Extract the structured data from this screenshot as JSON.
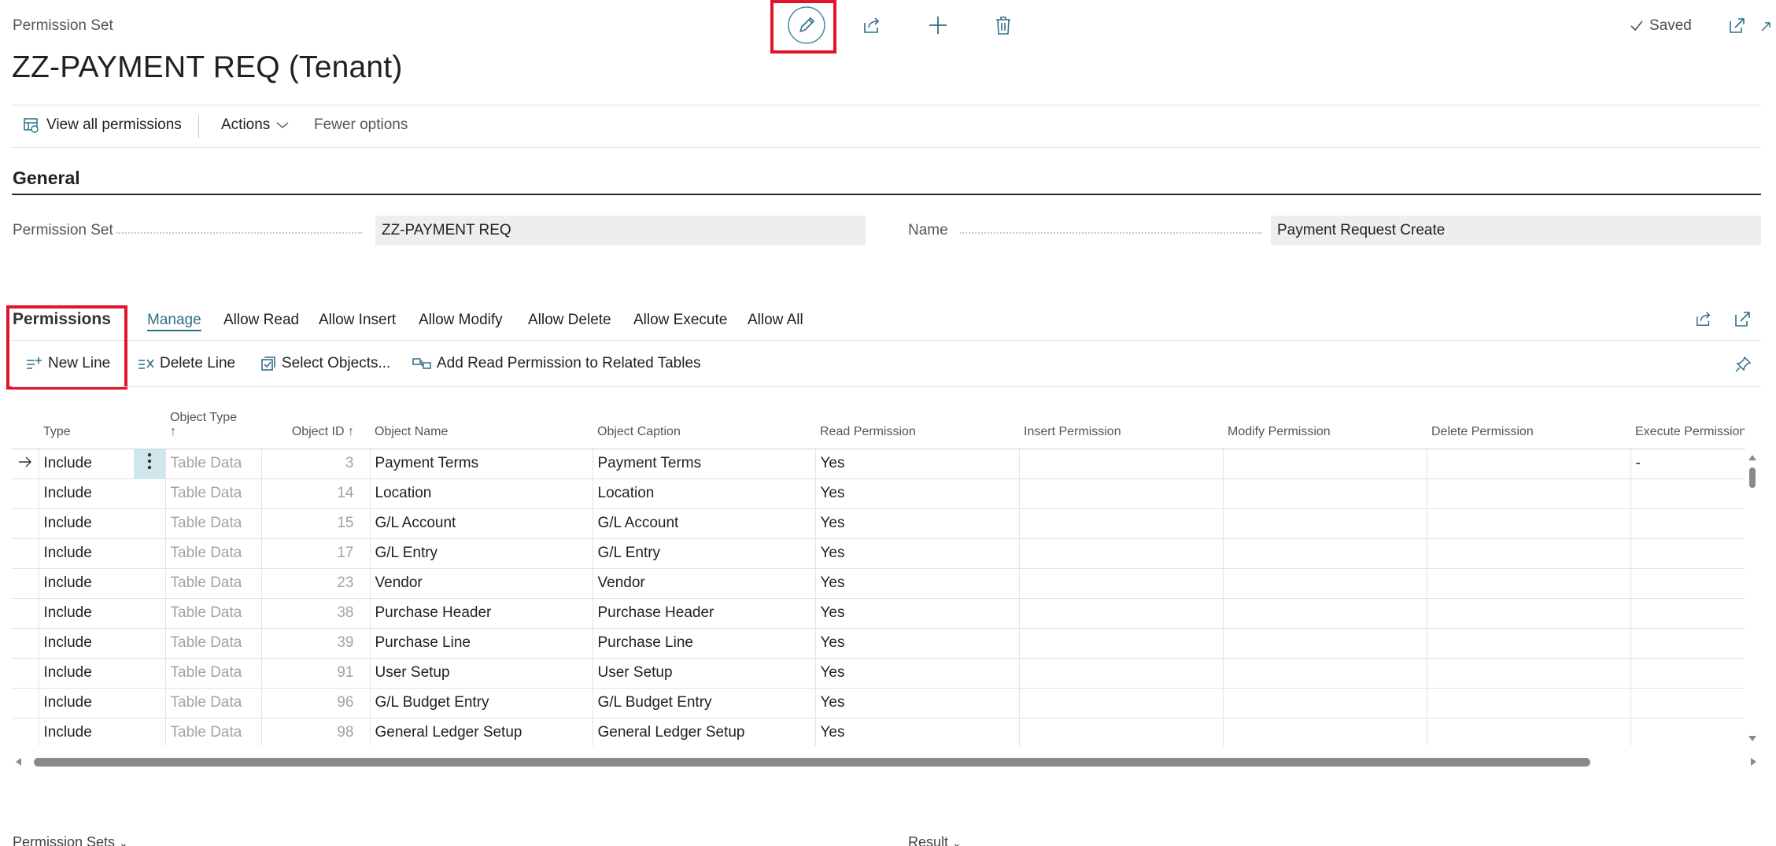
{
  "header": {
    "breadcrumb": "Permission Set",
    "title": "ZZ-PAYMENT REQ (Tenant)",
    "saved_label": "Saved"
  },
  "actions_bar": {
    "view_all": "View all permissions",
    "actions": "Actions",
    "fewer_options": "Fewer options"
  },
  "general": {
    "heading": "General",
    "permission_set_label": "Permission Set",
    "permission_set_value": "ZZ-PAYMENT REQ",
    "name_label": "Name",
    "name_value": "Payment Request Create"
  },
  "permissions": {
    "heading": "Permissions",
    "tabs": [
      "Manage",
      "Allow Read",
      "Allow Insert",
      "Allow Modify",
      "Allow Delete",
      "Allow Execute",
      "Allow All"
    ],
    "toolbar": {
      "new_line": "New Line",
      "delete_line": "Delete Line",
      "select_objects": "Select Objects...",
      "add_read": "Add Read Permission to Related Tables"
    },
    "columns": {
      "type": "Type",
      "object_type": "Object Type",
      "object_type_sort": "↑",
      "object_id": "Object ID",
      "object_id_sort": "↑",
      "object_name": "Object Name",
      "object_caption": "Object Caption",
      "read": "Read Permission",
      "insert": "Insert Permission",
      "modify": "Modify Permission",
      "delete": "Delete Permission",
      "execute": "Execute Permission"
    },
    "rows": [
      {
        "type": "Include",
        "object_type": "Table Data",
        "object_id": "3",
        "object_name": "Payment Terms",
        "object_caption": "Payment Terms",
        "read": "Yes",
        "insert": "",
        "modify": "",
        "delete": "",
        "execute": "-"
      },
      {
        "type": "Include",
        "object_type": "Table Data",
        "object_id": "14",
        "object_name": "Location",
        "object_caption": "Location",
        "read": "Yes",
        "insert": "",
        "modify": "",
        "delete": "",
        "execute": ""
      },
      {
        "type": "Include",
        "object_type": "Table Data",
        "object_id": "15",
        "object_name": "G/L Account",
        "object_caption": "G/L Account",
        "read": "Yes",
        "insert": "",
        "modify": "",
        "delete": "",
        "execute": ""
      },
      {
        "type": "Include",
        "object_type": "Table Data",
        "object_id": "17",
        "object_name": "G/L Entry",
        "object_caption": "G/L Entry",
        "read": "Yes",
        "insert": "",
        "modify": "",
        "delete": "",
        "execute": ""
      },
      {
        "type": "Include",
        "object_type": "Table Data",
        "object_id": "23",
        "object_name": "Vendor",
        "object_caption": "Vendor",
        "read": "Yes",
        "insert": "",
        "modify": "",
        "delete": "",
        "execute": ""
      },
      {
        "type": "Include",
        "object_type": "Table Data",
        "object_id": "38",
        "object_name": "Purchase Header",
        "object_caption": "Purchase Header",
        "read": "Yes",
        "insert": "",
        "modify": "",
        "delete": "",
        "execute": ""
      },
      {
        "type": "Include",
        "object_type": "Table Data",
        "object_id": "39",
        "object_name": "Purchase Line",
        "object_caption": "Purchase Line",
        "read": "Yes",
        "insert": "",
        "modify": "",
        "delete": "",
        "execute": ""
      },
      {
        "type": "Include",
        "object_type": "Table Data",
        "object_id": "91",
        "object_name": "User Setup",
        "object_caption": "User Setup",
        "read": "Yes",
        "insert": "",
        "modify": "",
        "delete": "",
        "execute": ""
      },
      {
        "type": "Include",
        "object_type": "Table Data",
        "object_id": "96",
        "object_name": "G/L Budget Entry",
        "object_caption": "G/L Budget Entry",
        "read": "Yes",
        "insert": "",
        "modify": "",
        "delete": "",
        "execute": ""
      },
      {
        "type": "Include",
        "object_type": "Table Data",
        "object_id": "98",
        "object_name": "General Ledger Setup",
        "object_caption": "General Ledger Setup",
        "read": "Yes",
        "insert": "",
        "modify": "",
        "delete": "",
        "execute": ""
      }
    ]
  },
  "bottom": {
    "permission_sets": "Permission Sets",
    "result": "Result"
  },
  "colors": {
    "accent": "#2f6f85",
    "highlight": "#e0142a",
    "field_bg": "#eceeef"
  },
  "icons": [
    "edit-pencil-icon",
    "share-icon",
    "add-icon",
    "delete-trash-icon",
    "check-icon",
    "open-new-window-icon",
    "collapse-icon",
    "view-permissions-icon",
    "chevron-down-icon",
    "new-line-icon",
    "delete-line-icon",
    "select-objects-icon",
    "related-tables-icon",
    "pin-icon",
    "row-arrow-icon",
    "row-menu-icon"
  ]
}
